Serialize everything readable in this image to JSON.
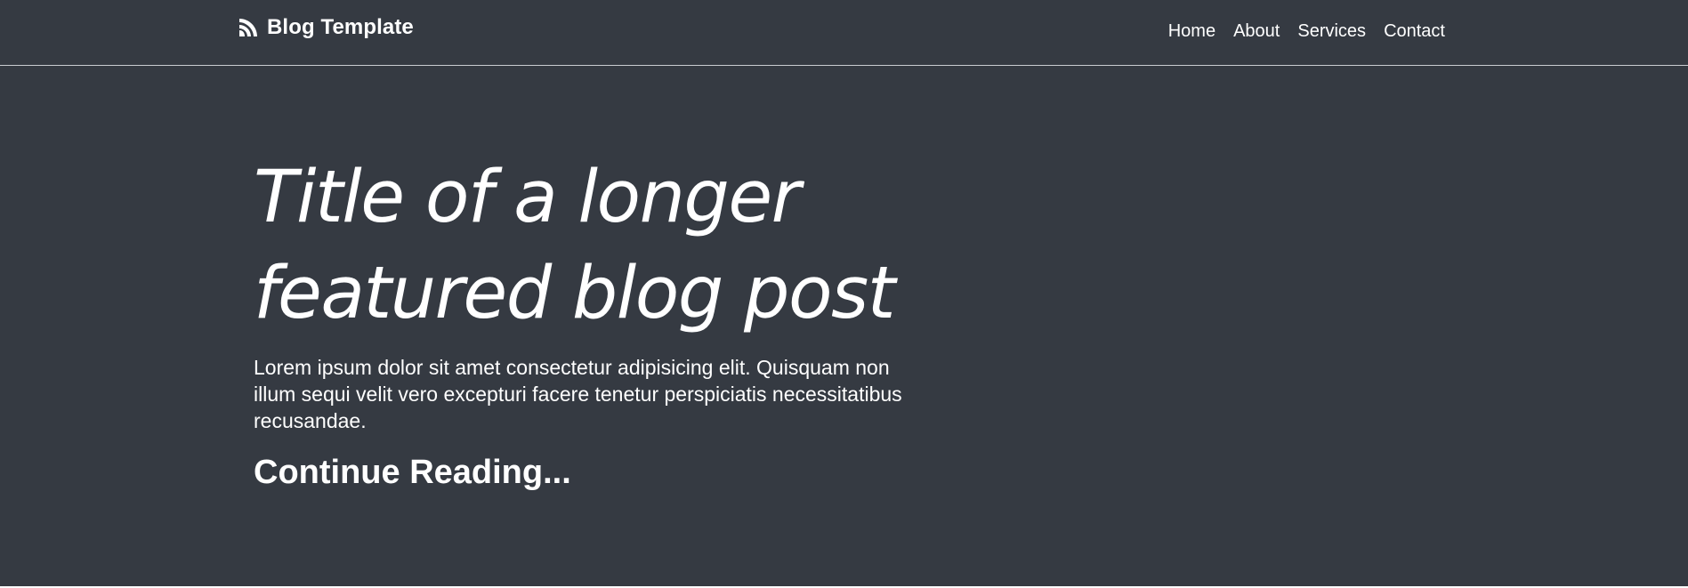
{
  "navbar": {
    "brand_icon": "rss-icon",
    "brand_text": "Blog Template",
    "links": [
      {
        "label": "Home"
      },
      {
        "label": "About"
      },
      {
        "label": "Services"
      },
      {
        "label": "Contact"
      }
    ]
  },
  "featured": {
    "title": "Title of a longer featured blog post",
    "lead": "Lorem ipsum dolor sit amet consectetur adipisicing elit. Quisquam non illum sequi velit vero excepturi facere tenetur perspiciatis necessitatibus recusandae.",
    "link_label": "Continue Reading..."
  },
  "colors": {
    "hero_background": "#353a42",
    "text": "#ffffff"
  }
}
